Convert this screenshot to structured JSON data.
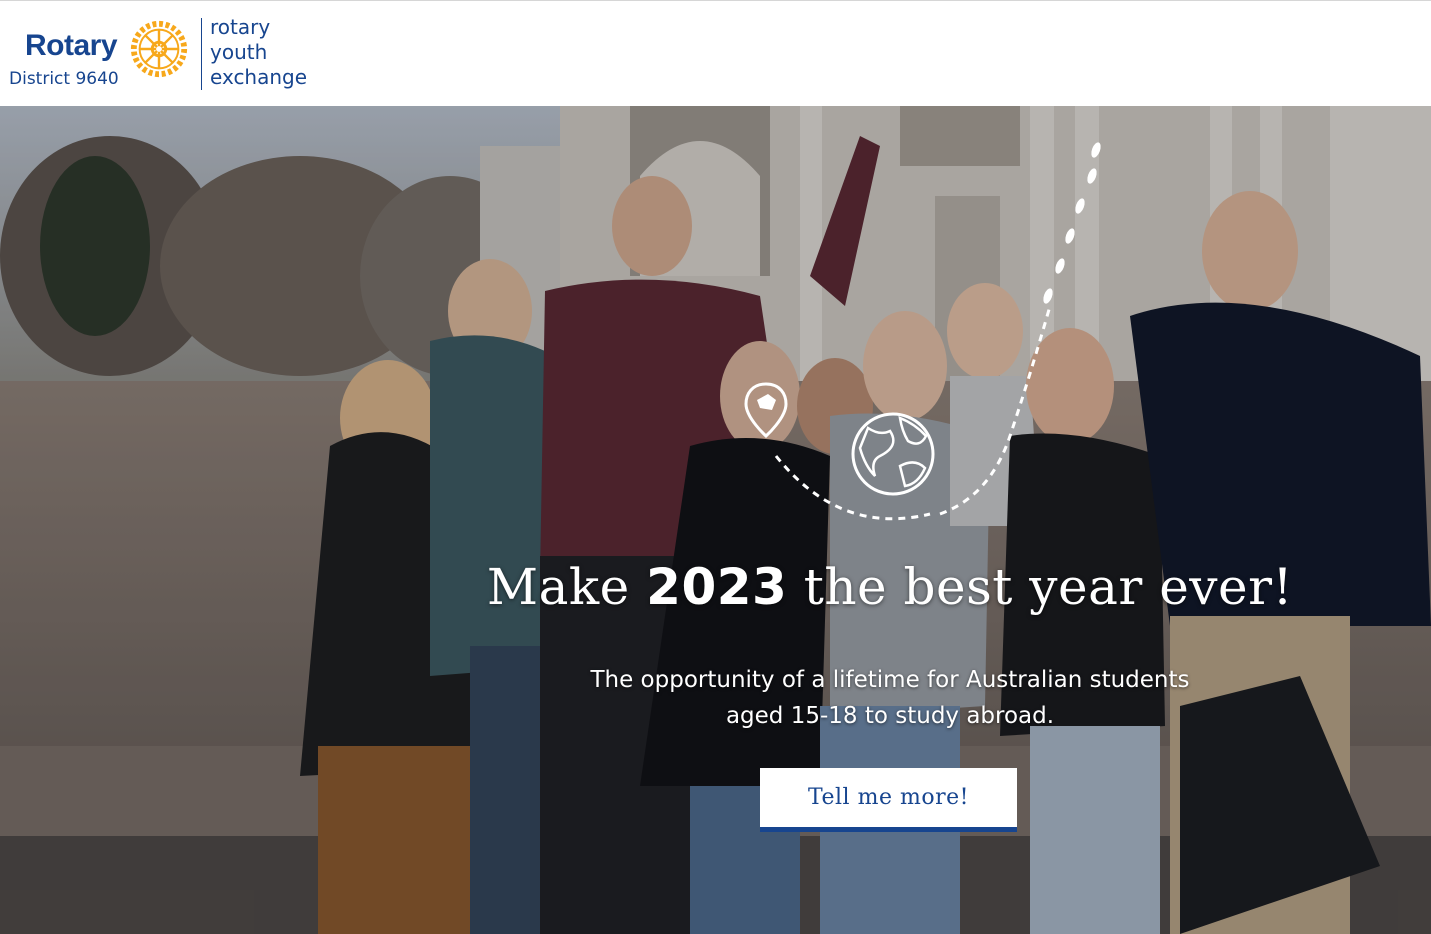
{
  "header": {
    "logo": {
      "brand": "Rotary",
      "district": "District 9640",
      "program_lines": [
        "rotary",
        "youth",
        "exchange"
      ]
    }
  },
  "hero": {
    "title_prefix": "Make ",
    "title_year": "2023",
    "title_suffix": " the best year ever!",
    "subtitle_lines": [
      "The opportunity of a lifetime for Australian students",
      "aged 15-18 to study abroad."
    ],
    "cta_label": "Tell me more!"
  },
  "colors": {
    "brand_blue": "#17458f",
    "rotary_gold": "#f7a81b",
    "white": "#ffffff"
  },
  "icons": [
    "rotary-wheel-icon",
    "location-pin-icon",
    "globe-icon",
    "footprints-icon"
  ]
}
